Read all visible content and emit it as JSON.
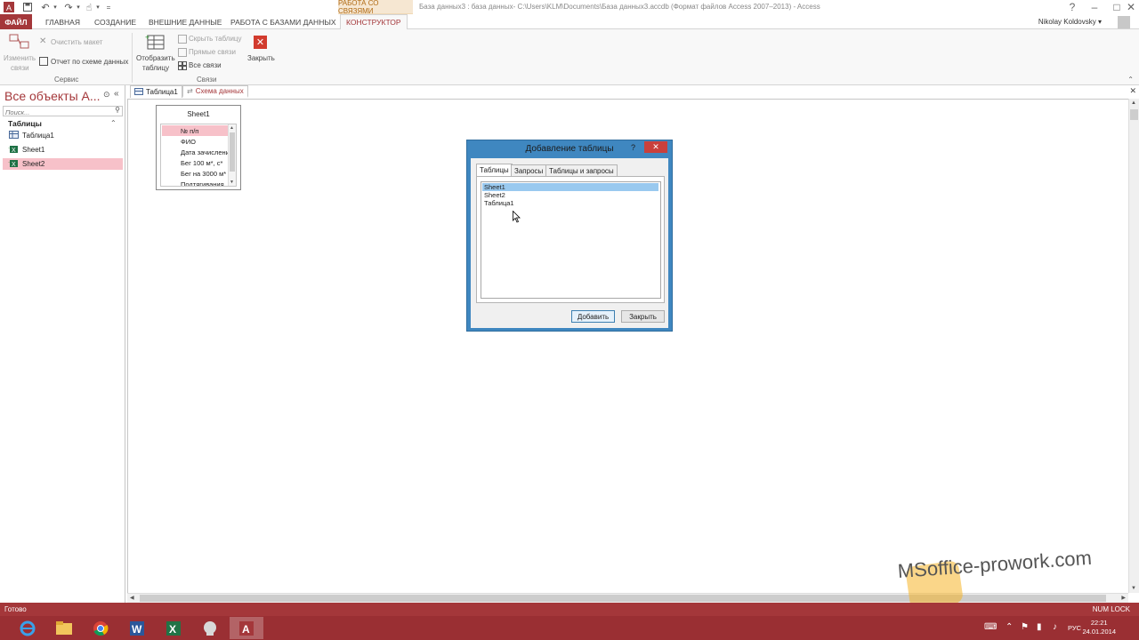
{
  "app": {
    "window_title": "База данных3 : база данных- C:\\Users\\KLM\\Documents\\База данных3.accdb (Формат файлов Access 2007–2013) - Access",
    "context_group": "РАБОТА СО СВЯЗЯМИ",
    "user": "Nikolay Koldovsky",
    "qat_more": "="
  },
  "tabs": {
    "file": "ФАЙЛ",
    "home": "ГЛАВНАЯ",
    "create": "СОЗДАНИЕ",
    "external": "ВНЕШНИЕ ДАННЫЕ",
    "dbtools": "РАБОТА С БАЗАМИ ДАННЫХ",
    "design": "КОНСТРУКТОР"
  },
  "ribbon": {
    "edit_relations_1": "Изменить",
    "edit_relations_2": "связи",
    "clear_layout": "Очистить макет",
    "relation_report": "Отчет по схеме данных",
    "tools_group": "Сервис",
    "show_table_1": "Отобразить",
    "show_table_2": "таблицу",
    "hide_table": "Скрыть таблицу",
    "direct_relations": "Прямые связи",
    "all_relations": "Все связи",
    "close": "Закрыть",
    "relations_group": "Связи"
  },
  "nav": {
    "title": "Все объекты А...",
    "search_placeholder": "Поиск...",
    "section": "Таблицы",
    "items": [
      {
        "label": "Таблица1",
        "icon": "table-icon"
      },
      {
        "label": "Sheet1",
        "icon": "linked-excel-table-icon"
      },
      {
        "label": "Sheet2",
        "icon": "linked-excel-table-icon"
      }
    ]
  },
  "doctabs": [
    {
      "label": "Таблица1"
    },
    {
      "label": "Схема данных"
    }
  ],
  "sheet1": {
    "title": "Sheet1",
    "fields": [
      "№ п/п",
      "ФИО",
      "Дата зачисления",
      "Бег 100 м*, с*",
      "Бег на 3000 м*",
      "Подтягивания"
    ]
  },
  "dialog": {
    "title": "Добавление таблицы",
    "help": "?",
    "tabs": [
      "Таблицы",
      "Запросы",
      "Таблицы и запросы"
    ],
    "items": [
      "Sheet1",
      "Sheet2",
      "Таблица1"
    ],
    "add_button": "Добавить",
    "close_button": "Закрыть"
  },
  "status": {
    "left": "Готово",
    "right": "NUM LOCK"
  },
  "watermark": "MSoffice-prowork.com",
  "taskbar": {
    "lang": "РУС",
    "time": "22:21",
    "date": "24.01.2014"
  },
  "colors": {
    "accent": "#a4373a",
    "selection": "#f7c1c9",
    "dialog_frame": "#3f87c0"
  }
}
